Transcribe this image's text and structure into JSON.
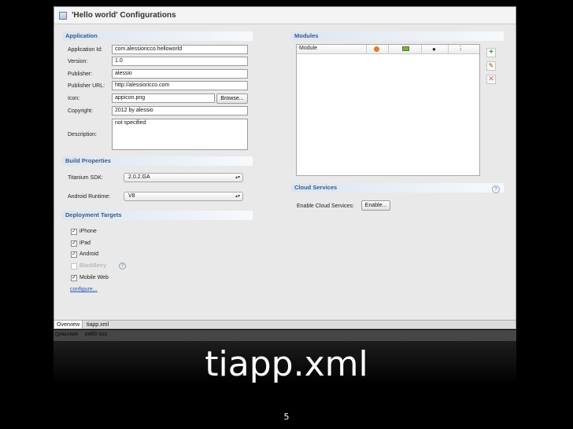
{
  "window": {
    "title": "'Hello world' Configurations"
  },
  "application": {
    "section_title": "Application",
    "fields": [
      {
        "label": "Application Id:",
        "value": "com.alessioricco.helloworld"
      },
      {
        "label": "Version:",
        "value": "1.0"
      },
      {
        "label": "Publisher:",
        "value": "alessio"
      },
      {
        "label": "Publisher URL:",
        "value": "http://alessioricco.com"
      },
      {
        "label": "Icon:",
        "value": "appicon.png"
      },
      {
        "label": "Copyright:",
        "value": "2012 by alessio"
      },
      {
        "label": "Description:",
        "value": "not specified"
      }
    ],
    "browse_label": "Browse..."
  },
  "build": {
    "section_title": "Build Properties",
    "sdk_label": "Titanium SDK:",
    "sdk_value": "2.0.2.GA",
    "runtime_label": "Android Runtime:",
    "runtime_value": "V8"
  },
  "deployment": {
    "section_title": "Deployment Targets",
    "targets": [
      {
        "label": "iPhone",
        "checked": true,
        "enabled": true
      },
      {
        "label": "iPad",
        "checked": true,
        "enabled": true
      },
      {
        "label": "Android",
        "checked": true,
        "enabled": true
      },
      {
        "label": "BlackBerry",
        "checked": false,
        "enabled": false
      },
      {
        "label": "Mobile Web",
        "checked": true,
        "enabled": true
      }
    ],
    "configure_label": "configure..."
  },
  "modules": {
    "section_title": "Modules",
    "column_module": "Module"
  },
  "cloud": {
    "section_title": "Cloud Services",
    "enable_label": "Enable Cloud Services:",
    "enable_button": "Enable..."
  },
  "tabs": [
    {
      "label": "Overview"
    },
    {
      "label": "tiapp.xml"
    }
  ],
  "slide": {
    "title": "tiapp.xml",
    "page": "5"
  },
  "colors": {
    "section_header": "#3a5b85",
    "link": "#2a55b8",
    "add": "#3a9a3a",
    "remove": "#d03a3a"
  }
}
